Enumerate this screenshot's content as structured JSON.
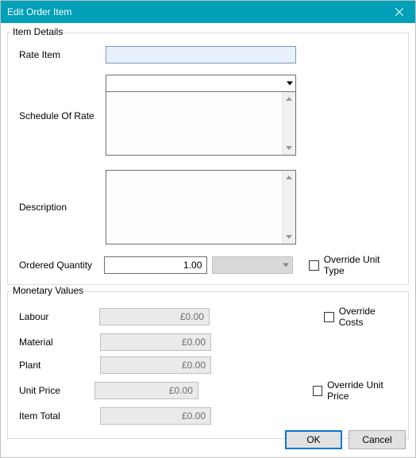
{
  "window": {
    "title": "Edit Order Item"
  },
  "groups": {
    "details": "Item Details",
    "monetary": "Monetary Values"
  },
  "labels": {
    "rateItem": "Rate Item",
    "scheduleOfRate": "Schedule Of Rate",
    "description": "Description",
    "orderedQuantity": "Ordered Quantity",
    "labour": "Labour",
    "material": "Material",
    "plant": "Plant",
    "unitPrice": "Unit Price",
    "itemTotal": "Item Total"
  },
  "fields": {
    "rateItem": "",
    "scheduleDropdown": "",
    "scheduleText": "",
    "descriptionText": "",
    "orderedQuantity": "1.00",
    "unitType": ""
  },
  "monetary": {
    "labour": "£0.00",
    "material": "£0.00",
    "plant": "£0.00",
    "unitPrice": "£0.00",
    "itemTotal": "£0.00"
  },
  "checkboxes": {
    "overrideUnitType": "Override Unit Type",
    "overrideCosts": "Override Costs",
    "overrideUnitPrice": "Override Unit Price"
  },
  "buttons": {
    "ok": "OK",
    "cancel": "Cancel"
  }
}
